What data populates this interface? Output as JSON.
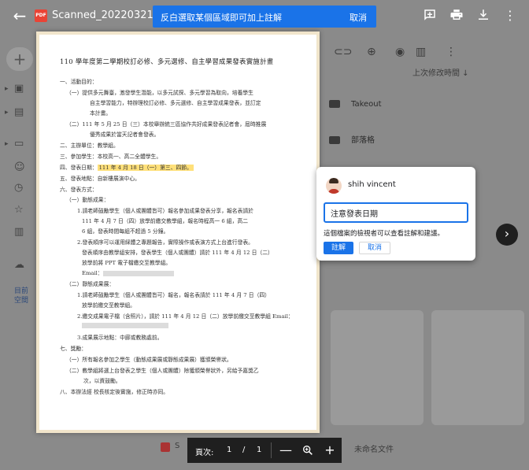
{
  "viewer": {
    "file_name": "Scanned_20220321-1016.pdf",
    "pdf_badge": "PDF",
    "banner_message": "反白選取某個區域即可加上註解",
    "banner_cancel": "取消"
  },
  "background": {
    "sort_label": "上次修改時間",
    "folders": [
      "Takeout",
      "部落格"
    ],
    "storage_text_1": "目前",
    "storage_text_2": "空間",
    "footer_text": "未命名文件"
  },
  "document": {
    "title": "110 學年度第二學期校訂必修、多元選修、自主學習成果發表實施計畫",
    "lines": [
      "一、活動目的：",
      "（一）提供多元舞臺，激發學生潛能，以多元試探、多元學習為取向，培養學生",
      "自主學習能力，特辦理校訂必修、多元選修、自主學習成果發表，並訂定",
      "本計畫。",
      "（二）111 年 5 月 25 日（三）本校舉辦統三區協作共好成果發表記者會，屆時推展",
      "優秀成果於當天記者會發表。",
      "二、主辦單位：教學組。",
      "三、參加學生：本校高一、高二全體學生。",
      "四、發表日期：",
      "111 年 4 月 18 日（一）第三、四節。",
      "五、發表地點：自新樓展演中心。",
      "六、發表方式：",
      "（一）動態成果：",
      "1.請老師鼓勵學生（個人或團體皆可）報名參加成果發表分享，報名表請於",
      "111 年 4 月 7 日（四）放學前繳交教學組，報名時程高一 6 組，高二",
      "6 組，發表時間每組不超過 5 分鐘。",
      "2.發表順序可以運用綵體之專題報告，實際操作或表演方式上台進行發表。",
      "發表順序由教學組安排，發表學生（個人或團體）請於 111 年 4 月 12 日（二）",
      "放學前將 PPT 電子檔繳交至教學組。",
      "Email：",
      "（二）靜態成果展：",
      "1.請老師鼓勵學生（個人或團體皆可）報名，報名表請於 111 年 4 月 7 日（四）",
      "放學前繳交至教學組。",
      "2.繳交成果電子檔（含照片），請於 111 年 4 月 12 日（二）放學前繳交至教學組 Email：",
      "3.成果展示地點：中廊或教務處前。",
      "七、獎勵：",
      "（一）所有報名參加之學生（動態成果展或靜態成果展）獲頒榮譽狀。",
      "（二）教學組將選上台發表之學生（個人或團體）除獲頒榮譽狀外，另給予嘉獎乙",
      "次，以資鼓勵。",
      "八、本辦法經 校長核定後實施，修正時亦同。"
    ]
  },
  "comment": {
    "user": "shih vincent",
    "input_value": "注意發表日期",
    "note": "這個檔案的檢視者可以查看註解和建議。",
    "submit": "註解",
    "cancel": "取消"
  },
  "pager": {
    "label": "頁次:",
    "current": "1",
    "separator": "/",
    "total": "1",
    "zoom_out": "—",
    "zoom_in": "+"
  },
  "icons": {
    "next": "chevron-right-icon",
    "back": "arrow-left-icon"
  }
}
